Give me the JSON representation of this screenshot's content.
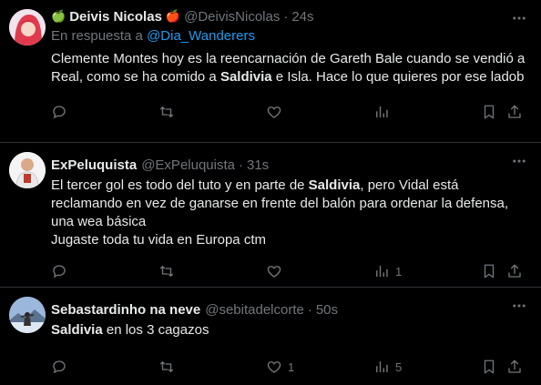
{
  "tweets": [
    {
      "name": "Deivis Nicolas",
      "name_prefix_emoji": "🍏",
      "name_suffix_emoji": "🍎",
      "handle": "@DeivisNicolas",
      "dot": "·",
      "time": "24s",
      "reply_prefix": "En respuesta a",
      "reply_to": "@Dia_Wanderers",
      "text_parts": [
        "Clemente Montes hoy es la reencarnación de Gareth Bale cuando se vendió a Real, como se ha comido a ",
        "Saldivia",
        " e Isla. Hace lo que quieres por ese ladob"
      ],
      "counts": {
        "reply": "",
        "retweet": "",
        "like": "",
        "views": ""
      }
    },
    {
      "name": "ExPeluquista",
      "handle": "@ExPeluquista",
      "dot": "·",
      "time": "31s",
      "text_parts": [
        "El tercer gol es todo del tuto y en parte de ",
        "Saldivia",
        ", pero Vidal está reclamando en vez de ganarse en frente del balón para ordenar la defensa, una wea básica",
        "Jugaste toda tu vida en Europa ctm"
      ],
      "counts": {
        "reply": "",
        "retweet": "",
        "like": "",
        "views": "1"
      }
    },
    {
      "name": "Sebastardinho na neve",
      "handle": "@sebitadelcorte",
      "dot": "·",
      "time": "50s",
      "text_parts": [
        "Saldivia",
        " en los 3 cagazos"
      ],
      "counts": {
        "reply": "",
        "retweet": "",
        "like": "1",
        "views": "5"
      }
    }
  ],
  "colors": {
    "background": "#000000",
    "text": "#e7e9ea",
    "muted": "#71767b",
    "link": "#1d9bf0",
    "divider": "#2f3336"
  },
  "icons": [
    "more-icon",
    "reply-icon",
    "retweet-icon",
    "like-icon",
    "views-icon",
    "bookmark-icon",
    "share-icon"
  ]
}
